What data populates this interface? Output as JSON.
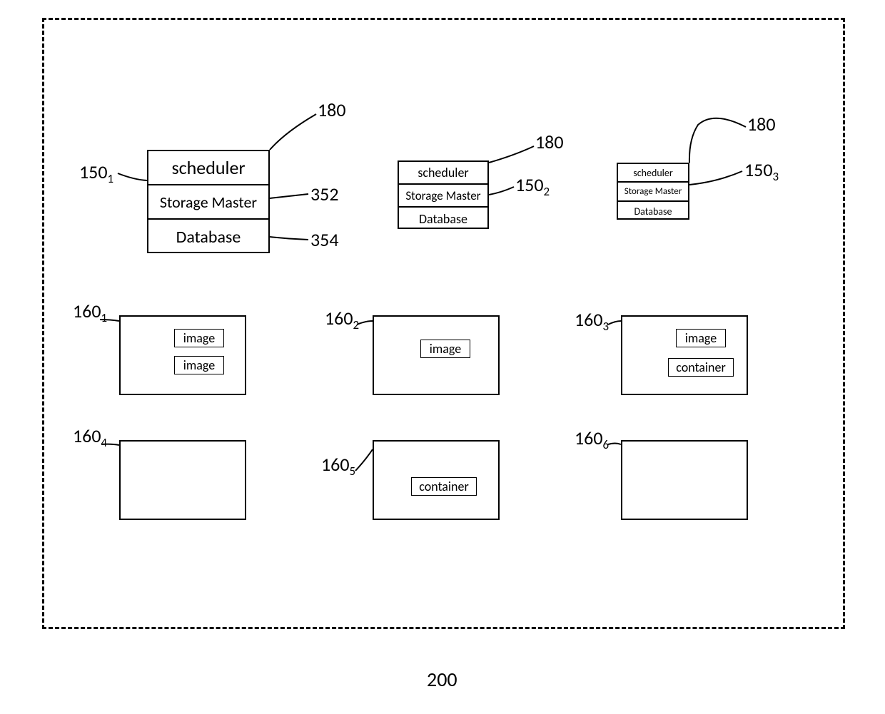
{
  "figure_number": "200",
  "stacks": {
    "s1": {
      "scheduler": "scheduler",
      "storage_master": "Storage Master",
      "database": "Database"
    },
    "s2": {
      "scheduler": "scheduler",
      "storage_master": "Storage Master",
      "database": "Database"
    },
    "s3": {
      "scheduler": "scheduler",
      "storage_master": "Storage Master",
      "database": "Database"
    }
  },
  "labels": {
    "l180a": "180",
    "l180b": "180",
    "l180c": "180",
    "l150_1": "150",
    "l150_1_sub": "1",
    "l150_2": "150",
    "l150_2_sub": "2",
    "l150_3": "150",
    "l150_3_sub": "3",
    "l352": "352",
    "l354": "354",
    "l160_1": "160",
    "l160_1_sub": "1",
    "l160_2": "160",
    "l160_2_sub": "2",
    "l160_3": "160",
    "l160_3_sub": "3",
    "l160_4": "160",
    "l160_4_sub": "4",
    "l160_5": "160",
    "l160_5_sub": "5",
    "l160_6": "160",
    "l160_6_sub": "6"
  },
  "chips": {
    "n1a": "image",
    "n1b": "image",
    "n2a": "image",
    "n3a": "image",
    "n3b": "container",
    "n5a": "container"
  },
  "chart_data": {
    "type": "diagram",
    "title": "200",
    "controllers": [
      {
        "id": "150_1",
        "components": [
          "scheduler",
          "Storage Master",
          "Database"
        ],
        "callouts": {
          "scheduler": 180,
          "storage_master": 352,
          "database": 354
        }
      },
      {
        "id": "150_2",
        "components": [
          "scheduler",
          "Storage Master",
          "Database"
        ],
        "callouts": {
          "scheduler": 180
        }
      },
      {
        "id": "150_3",
        "components": [
          "scheduler",
          "Storage Master",
          "Database"
        ],
        "callouts": {
          "scheduler": 180
        }
      }
    ],
    "nodes": [
      {
        "id": "160_1",
        "contents": [
          "image",
          "image"
        ]
      },
      {
        "id": "160_2",
        "contents": [
          "image"
        ]
      },
      {
        "id": "160_3",
        "contents": [
          "image",
          "container"
        ]
      },
      {
        "id": "160_4",
        "contents": []
      },
      {
        "id": "160_5",
        "contents": [
          "container"
        ]
      },
      {
        "id": "160_6",
        "contents": []
      }
    ]
  }
}
